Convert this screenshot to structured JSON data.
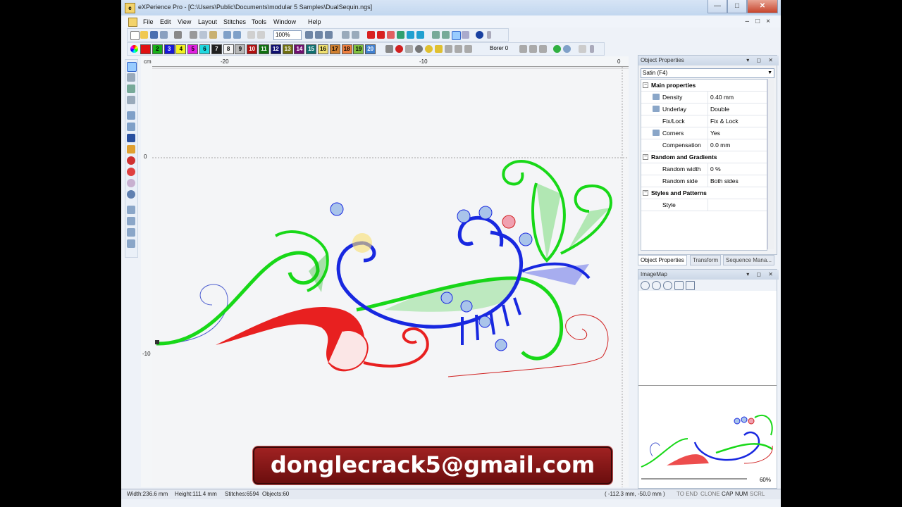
{
  "window": {
    "title": "eXPerience Pro - [C:\\Users\\Public\\Documents\\modular 5 Samples\\DualSequin.ngs]",
    "minimize": "—",
    "maximize": "□",
    "close": "✕"
  },
  "menu": [
    "File",
    "Edit",
    "View",
    "Layout",
    "Stitches",
    "Tools",
    "Window",
    "Help"
  ],
  "toolbar": {
    "zoom": "100%",
    "borer": "Borer 0"
  },
  "palette": [
    {
      "label": "",
      "color": "#e01010"
    },
    {
      "label": "2",
      "color": "#18b018"
    },
    {
      "label": "3",
      "color": "#1818d8"
    },
    {
      "label": "4",
      "color": "#f2f220"
    },
    {
      "label": "5",
      "color": "#e020e0"
    },
    {
      "label": "6",
      "color": "#20d8e0"
    },
    {
      "label": "7",
      "color": "#202020"
    },
    {
      "label": "8",
      "color": "#f4f4f4"
    },
    {
      "label": "9",
      "color": "#b8b8b8"
    },
    {
      "label": "10",
      "color": "#b01010"
    },
    {
      "label": "11",
      "color": "#107010"
    },
    {
      "label": "12",
      "color": "#101070"
    },
    {
      "label": "13",
      "color": "#707010"
    },
    {
      "label": "14",
      "color": "#701070"
    },
    {
      "label": "15",
      "color": "#107070"
    },
    {
      "label": "16",
      "color": "#f0e070"
    },
    {
      "label": "17",
      "color": "#d08030"
    },
    {
      "label": "18",
      "color": "#f08040"
    },
    {
      "label": "19",
      "color": "#80c040"
    },
    {
      "label": "20",
      "color": "#4080d0"
    }
  ],
  "ruler": {
    "unit": "cm",
    "top_labels": [
      "-20",
      "-10",
      "0"
    ],
    "left_labels": [
      "0",
      "-10"
    ]
  },
  "banner": {
    "text": "donglecrack5@gmail.com"
  },
  "object_properties": {
    "header": "Object Properties",
    "header_buttons": "▾ ◻ ✕",
    "selected": "Satin (F4)",
    "sections": [
      {
        "title": "Main properties",
        "rows": [
          {
            "name": "Density",
            "value": "0.40 mm"
          },
          {
            "name": "Underlay",
            "value": "Double"
          },
          {
            "name": "Fix/Lock",
            "value": "Fix & Lock"
          },
          {
            "name": "Corners",
            "value": "Yes"
          },
          {
            "name": "Compensation",
            "value": "0.0 mm"
          }
        ]
      },
      {
        "title": "Random and Gradients",
        "rows": [
          {
            "name": "Random width",
            "value": "0 %"
          },
          {
            "name": "Random side",
            "value": "Both sides"
          }
        ]
      },
      {
        "title": "Styles and Patterns",
        "rows": [
          {
            "name": "Style",
            "value": ""
          }
        ]
      }
    ],
    "tabs": [
      "Object Properties",
      "Transform",
      "Sequence Mana..."
    ]
  },
  "imagemap": {
    "header": "ImageMap",
    "header_buttons": "▾ ◻ ✕",
    "zoom": "60%"
  },
  "status": {
    "width": "Width:236.6 mm",
    "height": "Height:111.4 mm",
    "stitches": "Stitches:6594",
    "objects": "Objects:60",
    "coords": "( -112.3 mm, -50.0 mm )",
    "to_end": "TO END",
    "clone": "CLONE",
    "cap": "CAP",
    "num": "NUM",
    "scrl": "SCRL"
  }
}
